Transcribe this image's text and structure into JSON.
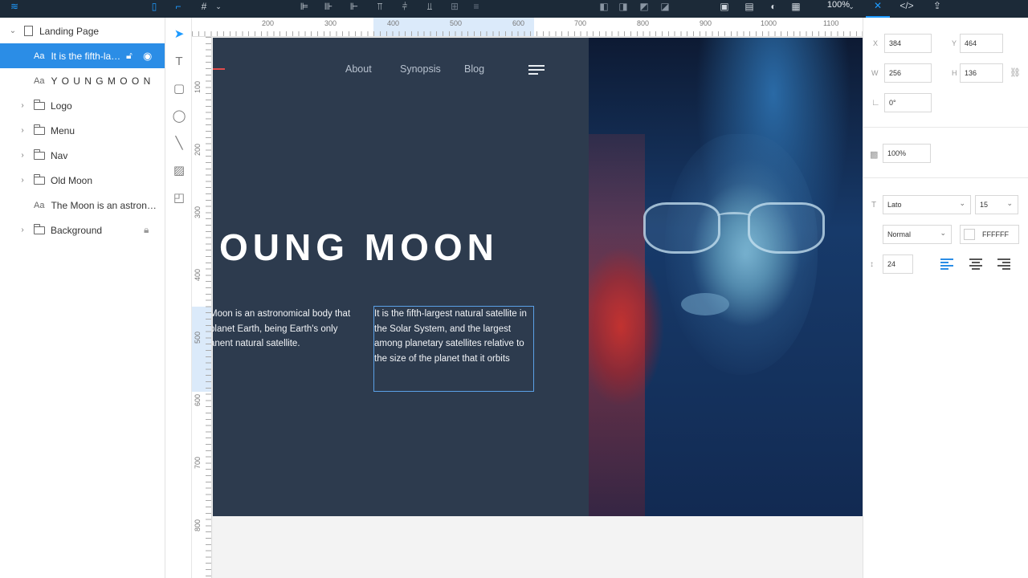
{
  "toolbar": {
    "zoom": "100%"
  },
  "layers": {
    "page": {
      "label": "Landing Page"
    },
    "items": [
      {
        "kind": "Aa",
        "label": "It is the fifth-lar...",
        "selected": true
      },
      {
        "kind": "Aa",
        "label": "Y O U N G  M O O N"
      },
      {
        "kind": "folder",
        "label": "Logo"
      },
      {
        "kind": "folder",
        "label": "Menu"
      },
      {
        "kind": "folder",
        "label": "Nav"
      },
      {
        "kind": "folder",
        "label": "Old Moon"
      },
      {
        "kind": "Aa",
        "label": "The Moon is an astrono..."
      },
      {
        "kind": "folder",
        "label": "Background",
        "locked": true
      }
    ]
  },
  "ruler": {
    "top": [
      "200",
      "300",
      "400",
      "500",
      "600",
      "700",
      "800",
      "900",
      "1000",
      "1100"
    ],
    "left": [
      "100",
      "200",
      "300",
      "400",
      "500",
      "600",
      "700",
      "800"
    ]
  },
  "artboard": {
    "nav": [
      "About",
      "Synopsis",
      "Blog"
    ],
    "title": "OUNG MOON",
    "para_left": "Moon is an astronomical body that planet Earth, being Earth's only anent natural satellite.",
    "para_right": "It is the fifth-largest natural satellite in the Solar System, and the largest among planetary satellites relative to the size of the planet that it orbits",
    "accent_color": "#e24b4b",
    "background_color": "#2d3b4e"
  },
  "inspector": {
    "x_label": "X",
    "x": "384",
    "y_label": "Y",
    "y": "464",
    "w_label": "W",
    "w": "256",
    "h_label": "H",
    "h": "136",
    "rotation": "0°",
    "opacity": "100%",
    "font": "Lato",
    "font_size": "15",
    "weight": "Normal",
    "color_hex": "FFFFFF",
    "line_height": "24"
  },
  "colors": {
    "accent": "#1e9bff",
    "selection": "#2b8de6"
  }
}
